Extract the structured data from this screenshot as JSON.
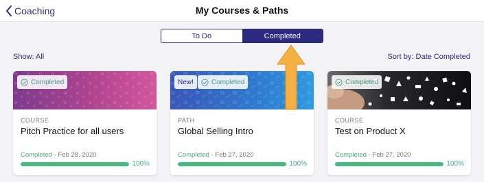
{
  "header": {
    "back_label": "Coaching",
    "title": "My Courses & Paths"
  },
  "tabs": [
    {
      "label": "To Do",
      "active": false
    },
    {
      "label": "Completed",
      "active": true
    }
  ],
  "filters": {
    "show_label": "Show: All",
    "sort_label": "Sort by: Date Completed"
  },
  "cards": [
    {
      "type": "COURSE",
      "title": "Pitch Practice for all users",
      "badge": "Completed",
      "new_badge": null,
      "status_word": "Completed",
      "status_date": " - Feb 28, 2020",
      "progress": 100,
      "progress_label": "100%",
      "banner": "purple-pink-pattern"
    },
    {
      "type": "PATH",
      "title": "Global Selling Intro",
      "badge": "Completed",
      "new_badge": "New!",
      "status_word": "Completed",
      "status_date": " - Feb 27, 2020",
      "progress": 100,
      "progress_label": "100%",
      "banner": "blue-pattern"
    },
    {
      "type": "COURSE",
      "title": "Test on Product X",
      "badge": "Completed",
      "new_badge": null,
      "status_word": "Completed",
      "status_date": " - Feb 27, 2020",
      "progress": 100,
      "progress_label": "100%",
      "banner": "hand-with-icons-photo"
    }
  ],
  "colors": {
    "accent": "#2c2a7e",
    "progress": "#48b882",
    "arrow": "#f5b041"
  },
  "icons": {
    "back": "chevron-left-icon",
    "badge": "check-circle-icon",
    "pointer": "arrow-up-icon"
  }
}
